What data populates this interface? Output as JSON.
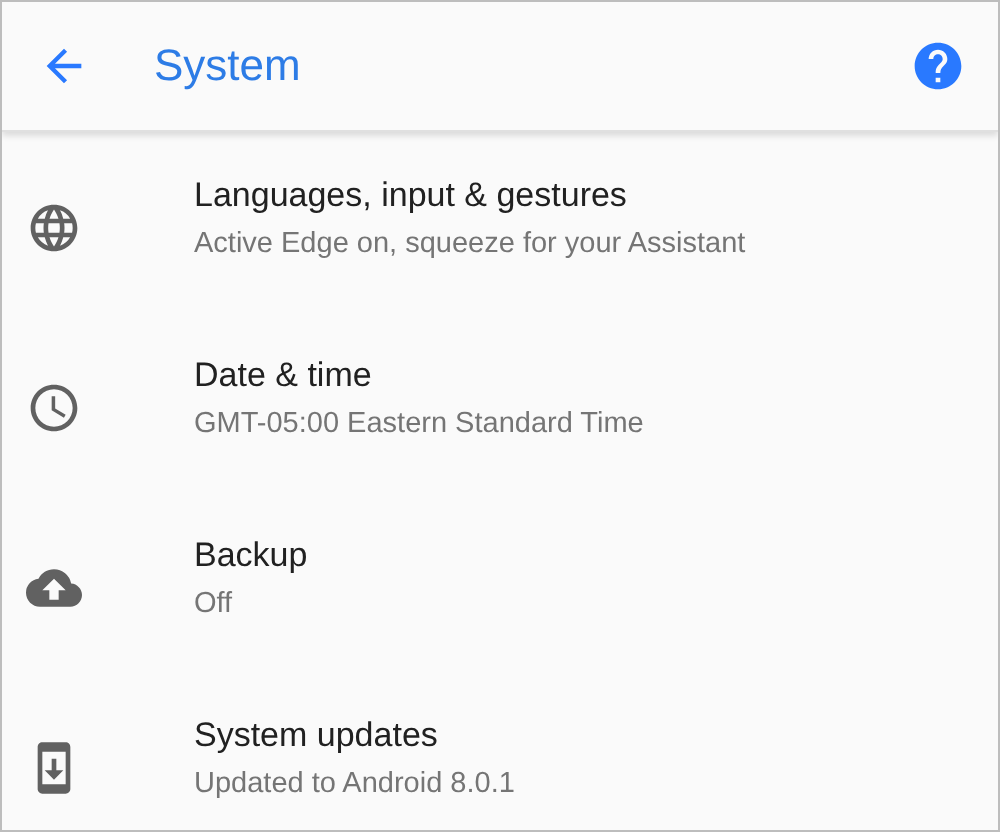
{
  "header": {
    "title": "System"
  },
  "items": [
    {
      "kind": "language",
      "title": "Languages, input & gestures",
      "summary": "Active Edge on, squeeze for your Assistant"
    },
    {
      "kind": "time",
      "title": "Date & time",
      "summary": "GMT-05:00 Eastern Standard Time"
    },
    {
      "kind": "backup",
      "title": "Backup",
      "summary": "Off"
    },
    {
      "kind": "update",
      "title": "System updates",
      "summary": "Updated to Android 8.0.1"
    }
  ]
}
